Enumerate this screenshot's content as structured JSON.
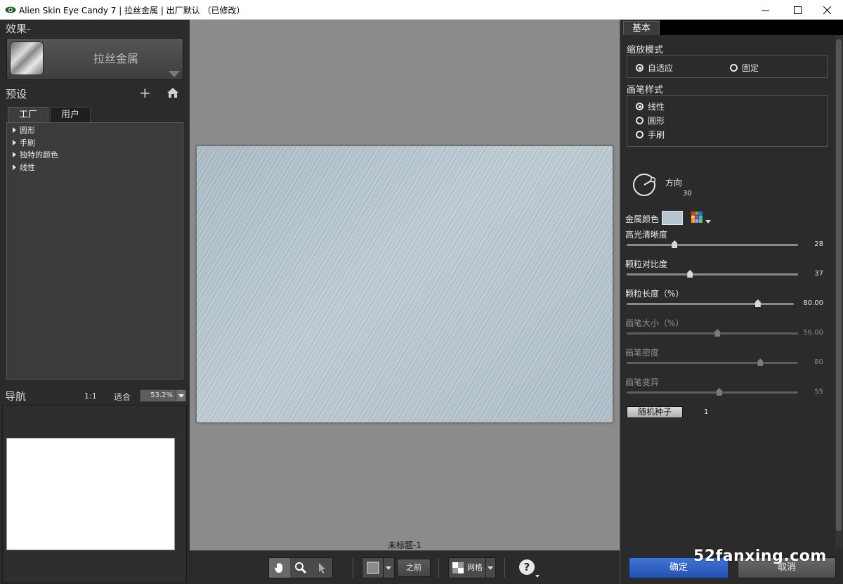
{
  "window": {
    "title": "Alien Skin Eye Candy 7 | 拉丝金属 | 出厂默认 （已修改）"
  },
  "left": {
    "effects_title": "效果-",
    "effect_name": "拉丝金属",
    "presets_title": "预设",
    "add_symbol": "+",
    "tabs": [
      "工厂",
      "用户"
    ],
    "tree_items": [
      "圆形",
      "手刷",
      "独特的颜色",
      "线性"
    ],
    "nav_title": "导航",
    "zoom_1to1": "1:1",
    "zoom_fit": "适合",
    "zoom_value": "53.2%"
  },
  "center": {
    "document_name": "未标题-1",
    "before_label": "之前",
    "grid_label": "网格"
  },
  "right": {
    "tab": "基本",
    "scale_mode_title": "缩放模式",
    "scale_options": [
      {
        "label": "自适应",
        "selected": true
      },
      {
        "label": "固定",
        "selected": false
      }
    ],
    "brush_style_title": "画笔样式",
    "brush_options": [
      {
        "label": "线性",
        "selected": true
      },
      {
        "label": "圆形",
        "selected": false
      },
      {
        "label": "手刷",
        "selected": false
      }
    ],
    "direction_label": "方向",
    "direction_value": "30",
    "metal_color_label": "金属颜色",
    "metal_color": "#b5c5cf",
    "sliders": [
      {
        "label": "高光清晰度",
        "value": "28",
        "fraction": 0.28,
        "enabled": true
      },
      {
        "label": "颗粒对比度",
        "value": "37",
        "fraction": 0.37,
        "enabled": true
      },
      {
        "label": "颗粒长度（%）",
        "value": "80.00",
        "fraction": 0.785,
        "enabled": true
      },
      {
        "label": "画笔大小（%）",
        "value": "56.00",
        "fraction": 0.53,
        "enabled": false
      },
      {
        "label": "画笔密度",
        "value": "80",
        "fraction": 0.78,
        "enabled": false
      },
      {
        "label": "画笔变异",
        "value": "55",
        "fraction": 0.54,
        "enabled": false
      }
    ],
    "seed_button": "随机种子",
    "seed_value": "1",
    "ok_button": "确定",
    "cancel_button": "取消"
  },
  "watermark": "52fanxing.com"
}
